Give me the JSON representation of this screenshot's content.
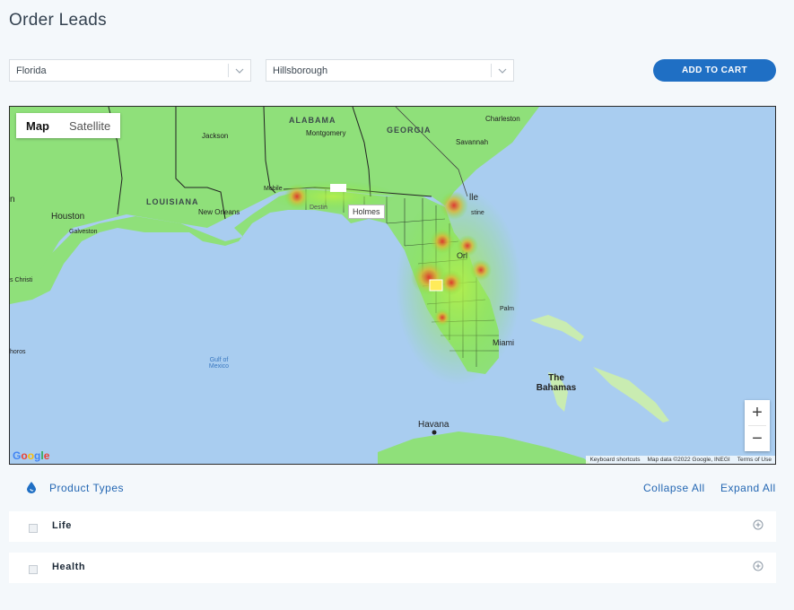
{
  "page": {
    "title": "Order Leads"
  },
  "filters": {
    "state": {
      "value": "Florida"
    },
    "county": {
      "value": "Hillsborough"
    },
    "add_to_cart_label": "ADD TO CART"
  },
  "map": {
    "type_controls": {
      "map_label": "Map",
      "satellite_label": "Satellite"
    },
    "tooltip": "Holmes",
    "labels": {
      "alabama": "ALABAMA",
      "georgia": "GEORGIA",
      "louisiana": "LOUISIANA",
      "montgomery": "Montgomery",
      "jackson": "Jackson",
      "charleston": "Charleston",
      "savannah": "Savannah",
      "new_orleans": "New Orleans",
      "houston": "Houston",
      "galveston": "Galveston",
      "mobile": "Mobile",
      "destin": "Destin",
      "jacksonville": "lle",
      "augustine": "stine",
      "orlando": "Orl",
      "palm": "Palm",
      "miami": "Miami",
      "corpus": "s Christi",
      "horos": "horos",
      "n_edge": "n",
      "gulf": "Gulf of Mexico",
      "bahamas": "The Bahamas",
      "havana": "Havana"
    },
    "zoom_in": "+",
    "zoom_out": "−",
    "google": "Google",
    "attribution": {
      "shortcuts": "Keyboard shortcuts",
      "data": "Map data ©2022 Google, INEGI",
      "terms": "Terms of Use"
    }
  },
  "products": {
    "title": "Product Types",
    "collapse_all": "Collapse All",
    "expand_all": "Expand All",
    "items": [
      {
        "name": "Life"
      },
      {
        "name": "Health"
      }
    ]
  },
  "colors": {
    "accent": "#1f6fc4",
    "heat_red": "#e0322a",
    "heat_green": "#7be34a",
    "land": "#8fe07a",
    "water": "#a9cdf0"
  }
}
